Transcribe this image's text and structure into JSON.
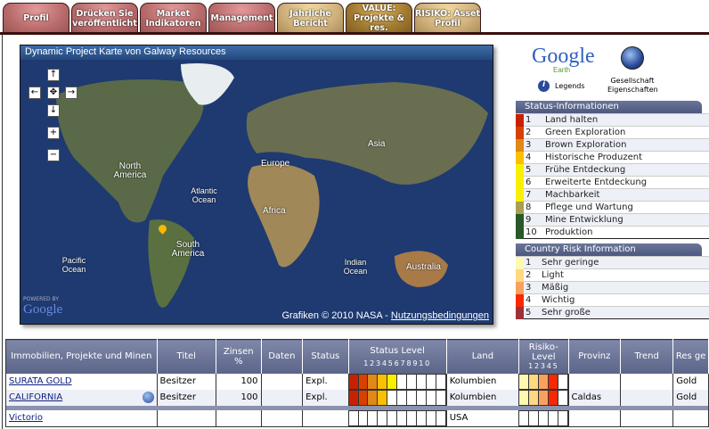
{
  "tabs": [
    {
      "label": "Profil",
      "style": "r"
    },
    {
      "label": "Drücken Sie veröffentlicht",
      "style": "r"
    },
    {
      "label": "Market Indikatoren",
      "style": "r"
    },
    {
      "label": "Management",
      "style": "r"
    },
    {
      "label": "Jährliche Bericht",
      "style": "g"
    },
    {
      "label": "VALUE: Projekte & res.",
      "style": "a"
    },
    {
      "label": "RISIKO: Asset Profil",
      "style": "g"
    }
  ],
  "map": {
    "title": "Dynamic Project Karte von Galway Resources",
    "labels": {
      "north_america": "North America",
      "atlantic": "Atlantic Ocean",
      "europe": "Europe",
      "asia": "Asia",
      "africa": "Africa",
      "south_america": "South America",
      "pacific": "Pacific Ocean",
      "indian": "Indian Ocean",
      "australia": "Australia"
    },
    "powered_by": "POWERED BY",
    "google": "Google",
    "attribution": "Grafiken © 2010 NASA - ",
    "terms_link": "Nutzungsbedingungen"
  },
  "google_earth": {
    "logo": "Google",
    "sub": "Earth",
    "legends": "Legends",
    "company_props": "Gesellschaft Eigenschaften"
  },
  "status_info": {
    "title": "Status-Informationen",
    "items": [
      {
        "n": "1",
        "label": "Land halten",
        "color": "#c82000"
      },
      {
        "n": "2",
        "label": "Green Exploration",
        "color": "#d84000"
      },
      {
        "n": "3",
        "label": "Brown Exploration",
        "color": "#e08818"
      },
      {
        "n": "4",
        "label": "Historische Produzent",
        "color": "#f8c000"
      },
      {
        "n": "5",
        "label": "Frühe Entdeckung",
        "color": "#f8f000"
      },
      {
        "n": "6",
        "label": "Erweiterte Entdeckung",
        "color": "#f8f000"
      },
      {
        "n": "7",
        "label": "Machbarkeit",
        "color": "#f8f000"
      },
      {
        "n": "8",
        "label": "Pflege und Wartung",
        "color": "#a8a050"
      },
      {
        "n": "9",
        "label": "Mine Entwicklung",
        "color": "#2a5828"
      },
      {
        "n": "10",
        "label": "Produktion",
        "color": "#2a5828"
      }
    ]
  },
  "country_risk": {
    "title": "Country Risk Information",
    "items": [
      {
        "n": "1",
        "label": "Sehr geringe",
        "color": "#fff8b0"
      },
      {
        "n": "2",
        "label": "Light",
        "color": "#ffd880"
      },
      {
        "n": "3",
        "label": "Mäßig",
        "color": "#f8a060"
      },
      {
        "n": "4",
        "label": "Wichtig",
        "color": "#f82800"
      },
      {
        "n": "5",
        "label": "Sehr große",
        "color": "#a03038"
      }
    ]
  },
  "table": {
    "headers": {
      "name": "Immobilien, Projekte und Minen",
      "titel": "Titel",
      "zinsen": "Zinsen",
      "pct": "%",
      "daten": "Daten",
      "status": "Status",
      "status_level": "Status Level",
      "land": "Land",
      "risiko": "Risiko- Level",
      "provinz": "Provinz",
      "trend": "Trend",
      "res": "Res ge"
    },
    "rows": [
      {
        "name": "SURATA GOLD",
        "titel": "Besitzer",
        "zinsen": "100",
        "daten": "",
        "status": "Expl.",
        "status_level": 5,
        "land": "Kolumbien",
        "risk_level": 4,
        "provinz": "",
        "trend": "",
        "res": "Gold"
      },
      {
        "name": "CALIFORNIA",
        "titel": "Besitzer",
        "zinsen": "100",
        "daten": "",
        "status": "Expl.",
        "status_level": 4,
        "land": "Kolumbien",
        "risk_level": 4,
        "provinz": "Caldas",
        "trend": "",
        "res": "Gold",
        "earth_icon": true
      },
      {
        "name": "Victorio",
        "titel": "",
        "zinsen": "",
        "daten": "",
        "status": "",
        "status_level": 0,
        "land": "USA",
        "risk_level": 0,
        "provinz": "",
        "trend": "",
        "res": ""
      }
    ]
  }
}
